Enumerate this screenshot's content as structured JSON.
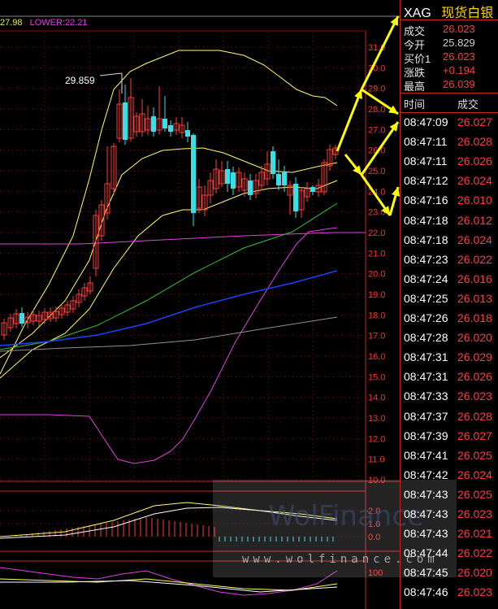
{
  "legend": {
    "upper": "27.98",
    "lower": "LOWER:22.21"
  },
  "peak_label": "29.859",
  "axis": {
    "main_ticks": [
      "31.0",
      "30.0",
      "29.0",
      "28.0",
      "27.0",
      "26.0",
      "25.0",
      "24.0",
      "23.0",
      "22.0",
      "21.0",
      "20.0",
      "19.0",
      "18.0",
      "17.0",
      "16.0",
      "15.0",
      "14.0",
      "13.0",
      "12.0",
      "11.0",
      "10.0"
    ],
    "macd_ticks": [
      "2.0",
      "1.0",
      "0.0"
    ],
    "osc_ticks": [
      "100"
    ]
  },
  "colors": {
    "up": "#ff3b3b",
    "down": "#36e0e6",
    "grid": "#8b0000",
    "ma_yellow": "#ffff66",
    "ma_green": "#30c030",
    "ma_blue": "#2040ff",
    "ma_gray": "#909090",
    "band_magenta": "#e040e0",
    "arrow": "#ffff00"
  },
  "quote": {
    "symbol": "XAG",
    "name": "现货白银",
    "rows": [
      {
        "label": "成交",
        "value": "26.023",
        "color": "red"
      },
      {
        "label": "今开",
        "value": "25.829",
        "color": "gray"
      },
      {
        "label": "买价1",
        "value": "26.023",
        "color": "red"
      },
      {
        "label": "涨跌",
        "value": "+0.194",
        "color": "red"
      },
      {
        "label": "最高",
        "value": "26.039",
        "color": "red"
      }
    ]
  },
  "ticks_header": {
    "time": "时间",
    "price": "成交"
  },
  "ticks": [
    {
      "time": "08:47:09",
      "price": "26.027"
    },
    {
      "time": "08:47:11",
      "price": "26.028"
    },
    {
      "time": "08:47:11",
      "price": "26.026"
    },
    {
      "time": "08:47:12",
      "price": "26.024"
    },
    {
      "time": "08:47:16",
      "price": "26.010"
    },
    {
      "time": "08:47:18",
      "price": "26.012"
    },
    {
      "time": "08:47:18",
      "price": "26.024"
    },
    {
      "time": "08:47:23",
      "price": "26.022"
    },
    {
      "time": "08:47:24",
      "price": "26.016"
    },
    {
      "time": "08:47:25",
      "price": "26.013"
    },
    {
      "time": "08:47:26",
      "price": "26.018"
    },
    {
      "time": "08:47:28",
      "price": "26.020"
    },
    {
      "time": "08:47:31",
      "price": "26.029"
    },
    {
      "time": "08:47:31",
      "price": "26.026"
    },
    {
      "time": "08:47:33",
      "price": "26.023"
    },
    {
      "time": "08:47:37",
      "price": "26.028"
    },
    {
      "time": "08:47:39",
      "price": "26.027"
    },
    {
      "time": "08:47:41",
      "price": "26.025"
    },
    {
      "time": "08:47:42",
      "price": "26.024"
    },
    {
      "time": "08:47:43",
      "price": "26.025"
    },
    {
      "time": "08:47:43",
      "price": "26.023"
    },
    {
      "time": "08:47:43",
      "price": "26.021"
    },
    {
      "time": "08:47:44",
      "price": "26.022"
    },
    {
      "time": "08:47:45",
      "price": "26.020"
    },
    {
      "time": "08:47:46",
      "price": "26.023"
    }
  ],
  "watermark": {
    "brand": "WolFinance",
    "url": "www.wolfinance.com"
  }
}
